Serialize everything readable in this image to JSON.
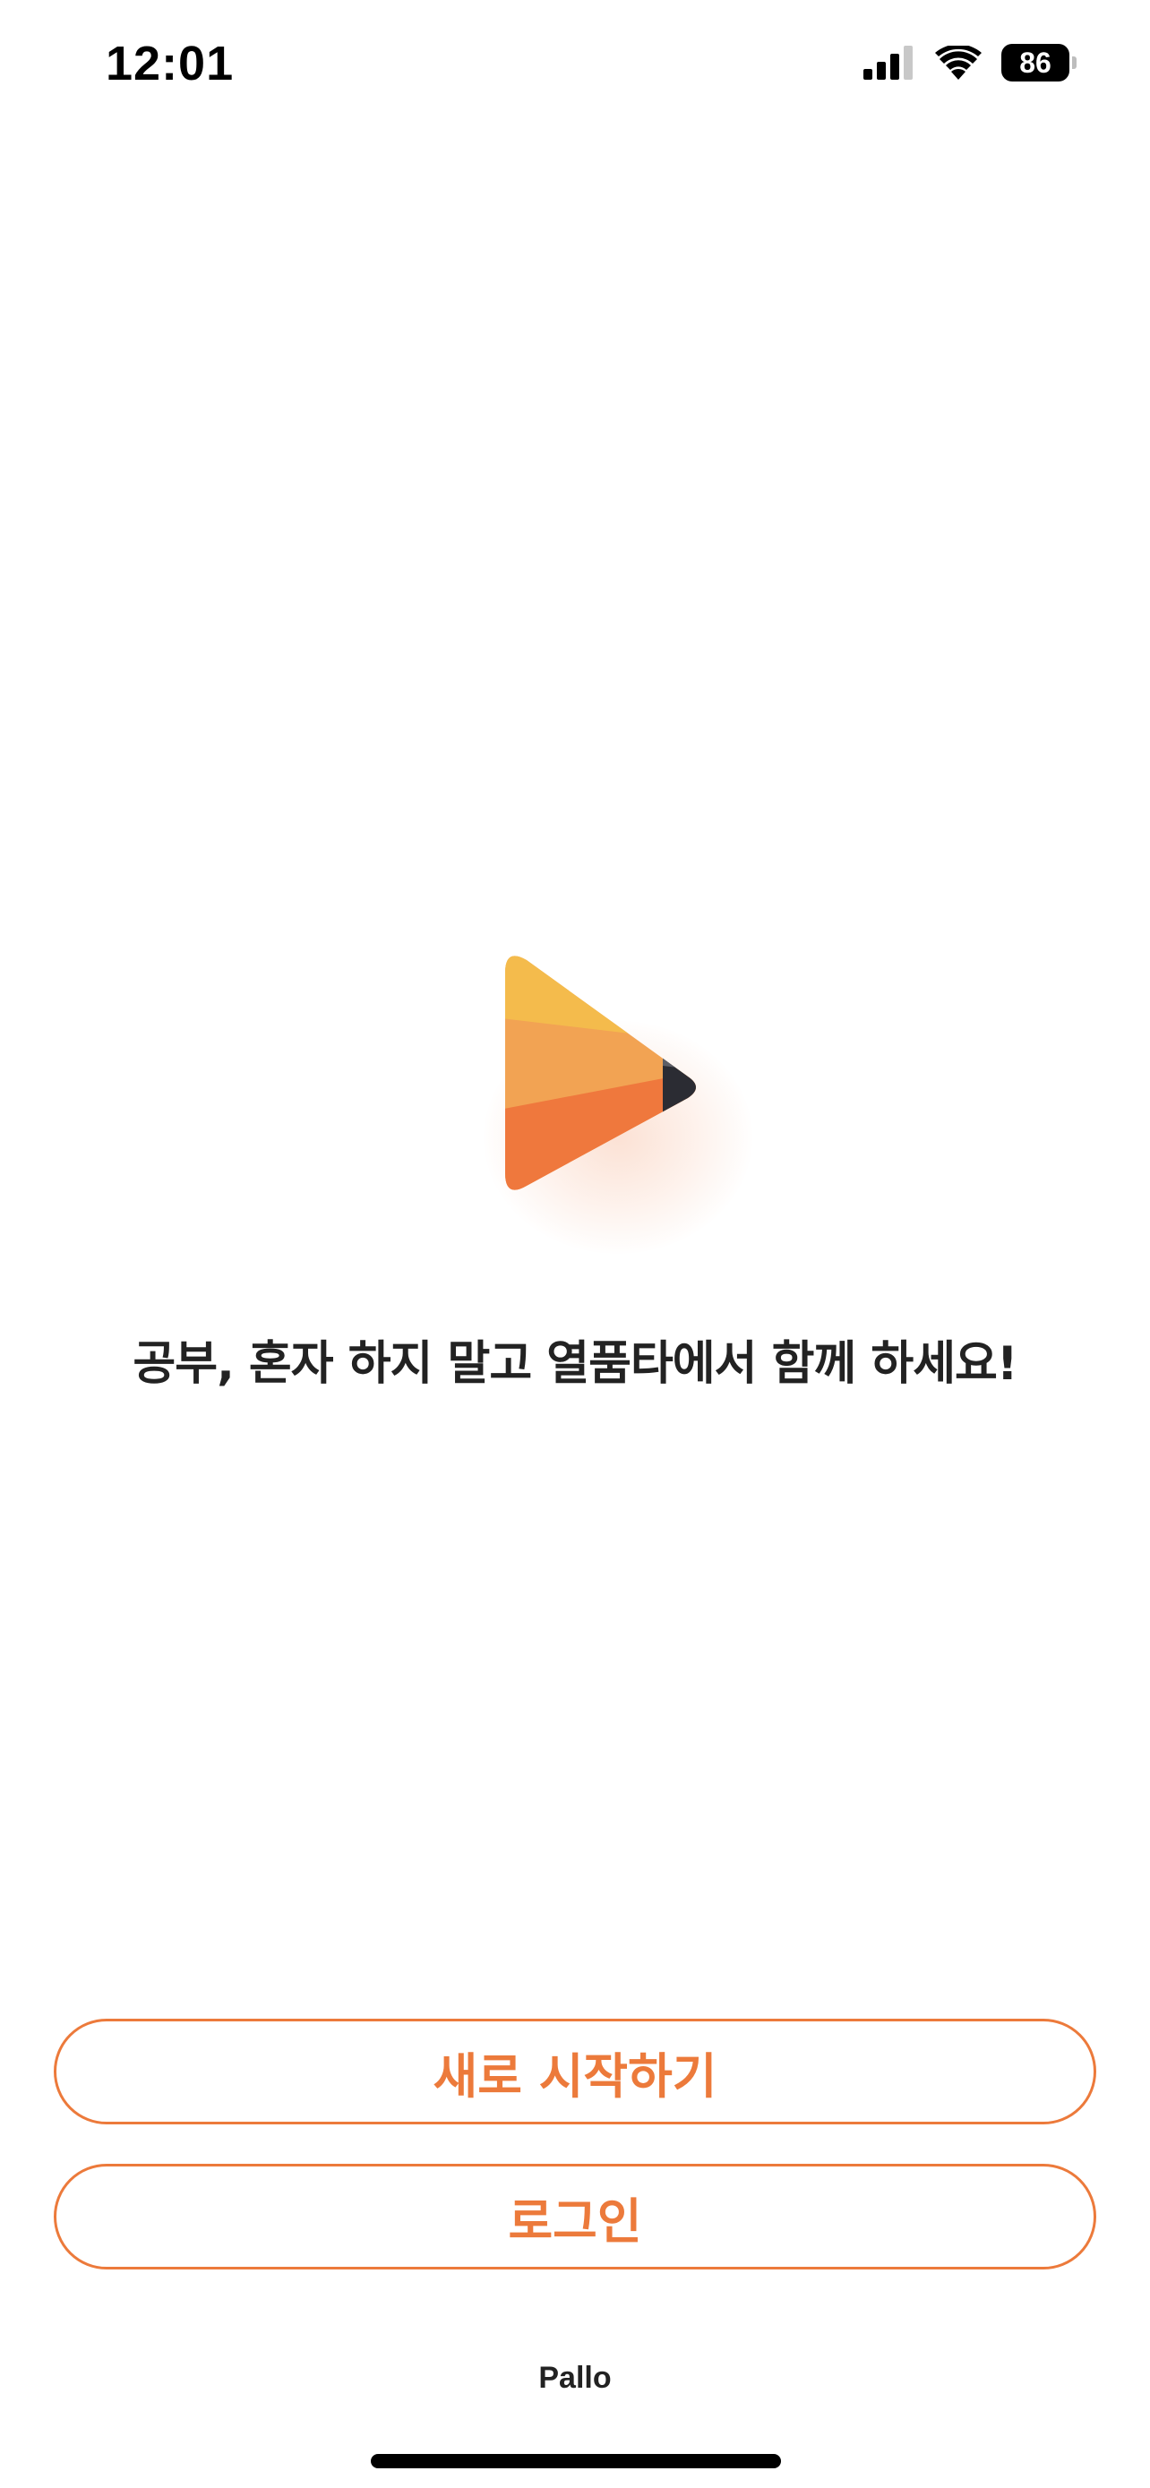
{
  "status_bar": {
    "time": "12:01",
    "battery_level": "86",
    "icons": [
      "signal-icon",
      "wifi-icon",
      "battery-icon"
    ]
  },
  "logo": {
    "icon": "play-triangle-logo",
    "colors": {
      "top": "#f4bb4c",
      "middle": "#f2a353",
      "bottom": "#ef783d",
      "tip_light": "#5d5f67",
      "tip_dark": "#2b2c33"
    }
  },
  "tagline": "공부, 혼자 하지 말고 열품타에서 함께 하세요!",
  "buttons": {
    "start_label": "새로 시작하기",
    "login_label": "로그인"
  },
  "brand": "Pallo",
  "colors": {
    "accent": "#ec7a3b",
    "text": "#222222",
    "background": "#ffffff"
  }
}
